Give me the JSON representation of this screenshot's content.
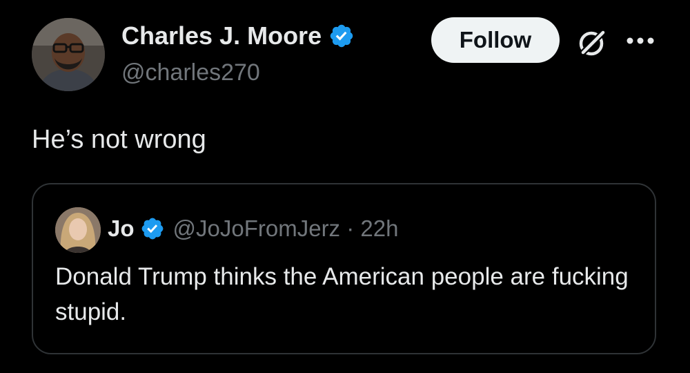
{
  "author": {
    "display_name": "Charles J. Moore",
    "handle": "@charles270",
    "verified_icon": "verified-badge-icon"
  },
  "actions": {
    "follow_label": "Follow",
    "grok_icon": "grok-icon",
    "more_icon": "more-options-icon"
  },
  "tweet": {
    "text": "He’s not wrong"
  },
  "quoted": {
    "display_name": "Jo",
    "handle": "@JoJoFromJerz",
    "separator": " · ",
    "timestamp": "22h",
    "text": "Donald Trump thinks the American people are fucking stupid."
  },
  "colors": {
    "background": "#000000",
    "text_primary": "#e7e9ea",
    "text_secondary": "#71767b",
    "verified_blue": "#1d9bf0",
    "border": "#2f3336"
  }
}
